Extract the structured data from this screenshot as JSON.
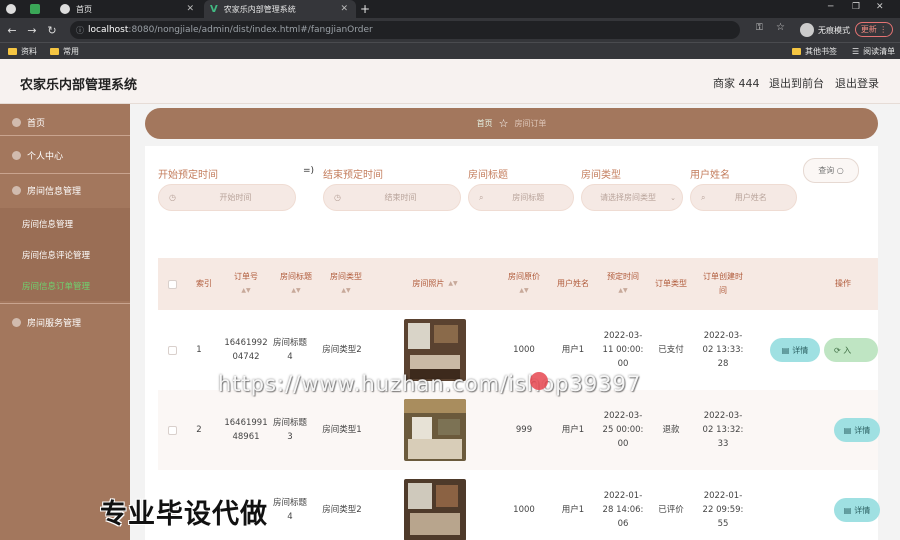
{
  "browser": {
    "tabs": [
      {
        "label": ""
      },
      {
        "label": ""
      },
      {
        "label": "首页"
      },
      {
        "label": "农家乐内部管理系统"
      }
    ],
    "new_tab": "+",
    "url_host": "localhost",
    "url_path": ":8080/nongjiale/admin/dist/index.html#/fangjianOrder",
    "incognito_label": "无痕模式",
    "update_label": "更新",
    "bookmarks": [
      {
        "label": "资料"
      },
      {
        "label": "常用"
      },
      {
        "label": "其他书签"
      },
      {
        "label": "阅读清单"
      }
    ]
  },
  "header": {
    "title": "农家乐内部管理系统",
    "user": "商家 444",
    "to_front": "退出到前台",
    "logout": "退出登录"
  },
  "sidebar": {
    "items": [
      {
        "label": "首页"
      },
      {
        "label": "个人中心"
      },
      {
        "label": "房间信息管理"
      },
      {
        "label": "房间信息管理"
      },
      {
        "label": "房间信息评论管理"
      },
      {
        "label": "房间信息订单管理"
      },
      {
        "label": "房间服务管理"
      }
    ]
  },
  "breadcrumb": {
    "home": "首页",
    "current": "房间订单"
  },
  "filters": {
    "start_label": "开始预定时间",
    "start_placeholder": "开始时间",
    "separator": "=)",
    "end_label": "结束预定时间",
    "end_placeholder": "结束时间",
    "title_label": "房间标题",
    "title_placeholder": "房间标题",
    "type_label": "房间类型",
    "type_placeholder": "请选择房间类型",
    "user_label": "用户姓名",
    "user_placeholder": "用户姓名",
    "query_label": "查询"
  },
  "table": {
    "headers": {
      "index": "索引",
      "order_no": "订单号",
      "room_title": "房间标题",
      "room_type": "房间类型",
      "photo": "房间照片",
      "price": "房间原价",
      "user": "用户姓名",
      "book_time": "预定时间",
      "order_type": "订单类型",
      "created": "订单创建时间",
      "actions": "操作"
    },
    "rows": [
      {
        "index": "1",
        "order_no": "1646199204742",
        "room_title": "房间标题4",
        "room_type": "房间类型2",
        "price": "1000",
        "user": "用户1",
        "book_time": "2022-03-11 00:00:00",
        "order_type": "已支付",
        "created": "2022-03-02 13:33:28",
        "detail": "详情",
        "extra": "入"
      },
      {
        "index": "2",
        "order_no": "1646199148961",
        "room_title": "房间标题3",
        "room_type": "房间类型1",
        "price": "999",
        "user": "用户1",
        "book_time": "2022-03-25 00:00:00",
        "order_type": "退款",
        "created": "2022-03-02 13:32:33",
        "detail": "详情"
      },
      {
        "index": "",
        "order_no": "",
        "room_title": "房间标题4",
        "room_type": "房间类型2",
        "price": "1000",
        "user": "用户1",
        "book_time": "2022-01-28 14:06:06",
        "order_type": "已评价",
        "created": "2022-01-22 09:59:55",
        "detail": "详情"
      }
    ]
  },
  "overlay": {
    "watermark": "https://www.huzhan.com/ishop39397",
    "caption": "专业毕设代做"
  },
  "colors": {
    "brand": "#a3775d",
    "active_menu": "#6fd36f",
    "detail_button": "#9fe0e2",
    "label": "#c47e5e"
  }
}
